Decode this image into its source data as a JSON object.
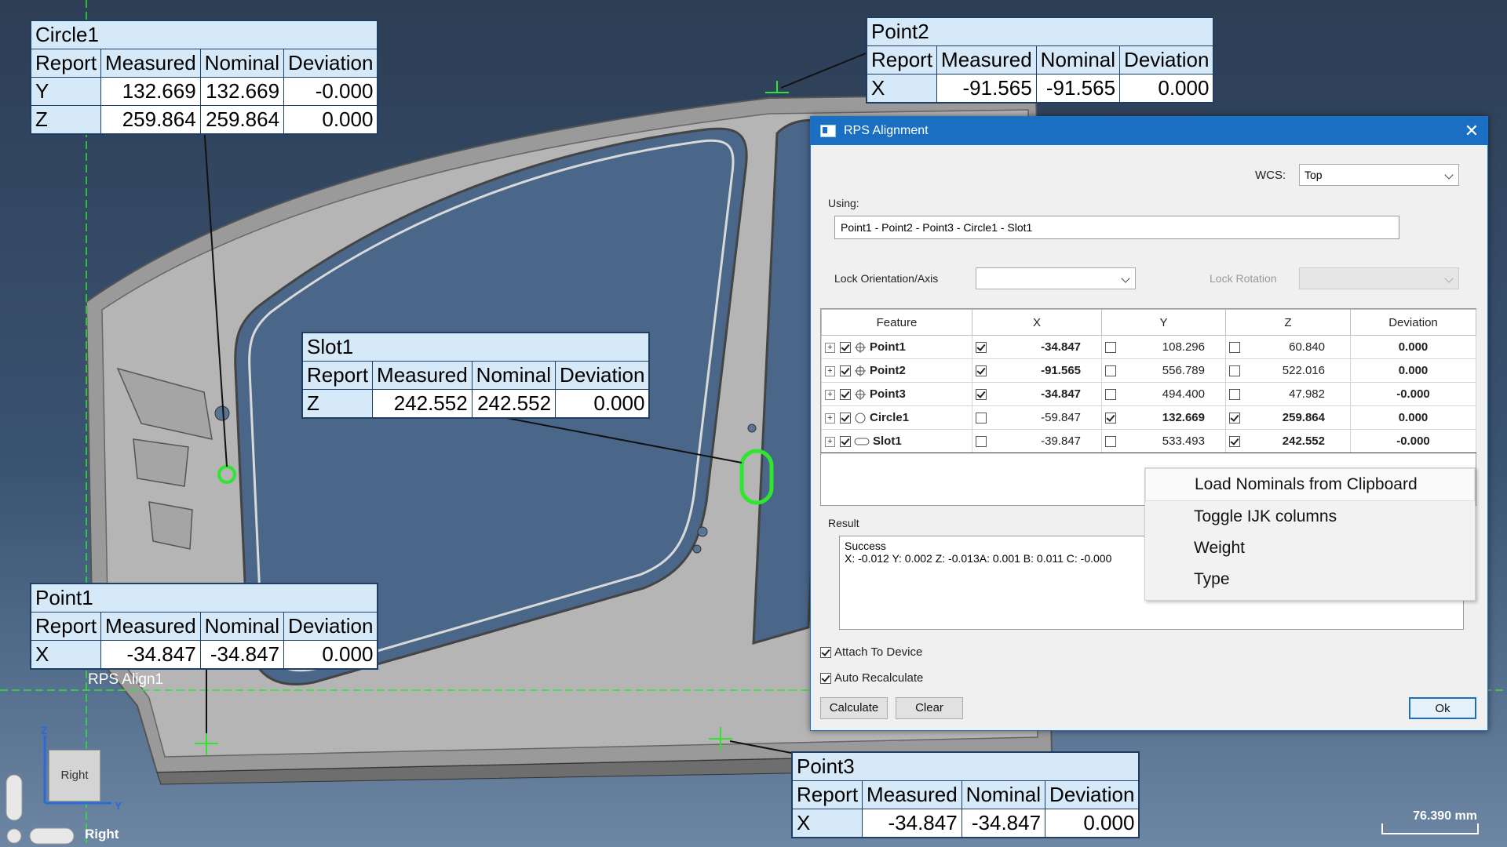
{
  "viewport": {
    "rps_label": "RPS Align1",
    "view_name": "Right",
    "cube_label": "Right",
    "scale_text": "76.390 mm",
    "axis_z": "Z",
    "axis_y": "Y"
  },
  "callouts": {
    "circle1": {
      "title": "Circle1",
      "headers": [
        "Report",
        "Measured",
        "Nominal",
        "Deviation"
      ],
      "rows": [
        [
          "Y",
          "132.669",
          "132.669",
          "-0.000"
        ],
        [
          "Z",
          "259.864",
          "259.864",
          "0.000"
        ]
      ]
    },
    "point2": {
      "title": "Point2",
      "headers": [
        "Report",
        "Measured",
        "Nominal",
        "Deviation"
      ],
      "rows": [
        [
          "X",
          "-91.565",
          "-91.565",
          "0.000"
        ]
      ]
    },
    "slot1": {
      "title": "Slot1",
      "headers": [
        "Report",
        "Measured",
        "Nominal",
        "Deviation"
      ],
      "rows": [
        [
          "Z",
          "242.552",
          "242.552",
          "0.000"
        ]
      ]
    },
    "point1": {
      "title": "Point1",
      "headers": [
        "Report",
        "Measured",
        "Nominal",
        "Deviation"
      ],
      "rows": [
        [
          "X",
          "-34.847",
          "-34.847",
          "0.000"
        ]
      ]
    },
    "point3": {
      "title": "Point3",
      "headers": [
        "Report",
        "Measured",
        "Nominal",
        "Deviation"
      ],
      "rows": [
        [
          "X",
          "-34.847",
          "-34.847",
          "0.000"
        ]
      ]
    }
  },
  "dialog": {
    "title": "RPS Alignment",
    "close": "✕",
    "wcs_label": "WCS:",
    "wcs_value": "Top",
    "using_label": "Using:",
    "using_value": "Point1 - Point2 - Point3 - Circle1 - Slot1",
    "lock_orientation_label": "Lock Orientation/Axis",
    "lock_rotation_label": "Lock Rotation",
    "columns": [
      "Feature",
      "X",
      "Y",
      "Z",
      "Deviation"
    ],
    "rows": [
      {
        "name": "Point1",
        "icon": "point-icon",
        "x_check": true,
        "x": "-34.847",
        "y_check": false,
        "y": "108.296",
        "z_check": false,
        "z": "60.840",
        "deviation": "0.000"
      },
      {
        "name": "Point2",
        "icon": "point-icon",
        "x_check": true,
        "x": "-91.565",
        "y_check": false,
        "y": "556.789",
        "z_check": false,
        "z": "522.016",
        "deviation": "0.000"
      },
      {
        "name": "Point3",
        "icon": "point-icon",
        "x_check": true,
        "x": "-34.847",
        "y_check": false,
        "y": "494.400",
        "z_check": false,
        "z": "47.982",
        "deviation": "-0.000"
      },
      {
        "name": "Circle1",
        "icon": "circle-icon",
        "x_check": false,
        "x": "-59.847",
        "y_check": true,
        "y": "132.669",
        "z_check": true,
        "z": "259.864",
        "deviation": "0.000"
      },
      {
        "name": "Slot1",
        "icon": "slot-icon",
        "x_check": false,
        "x": "-39.847",
        "y_check": false,
        "y": "533.493",
        "z_check": true,
        "z": "242.552",
        "deviation": "-0.000"
      }
    ],
    "result_label": "Result",
    "result_status": "Success",
    "result_values": "X: -0.012 Y: 0.002 Z: -0.013A: 0.001 B: 0.011 C: -0.000",
    "attach_label": "Attach To Device",
    "auto_recalc_label": "Auto Recalculate",
    "calculate_label": "Calculate",
    "clear_label": "Clear",
    "ok_label": "Ok"
  },
  "context_menu": {
    "items": [
      "Load Nominals from Clipboard",
      "Toggle IJK columns",
      "Weight",
      "Type"
    ]
  }
}
